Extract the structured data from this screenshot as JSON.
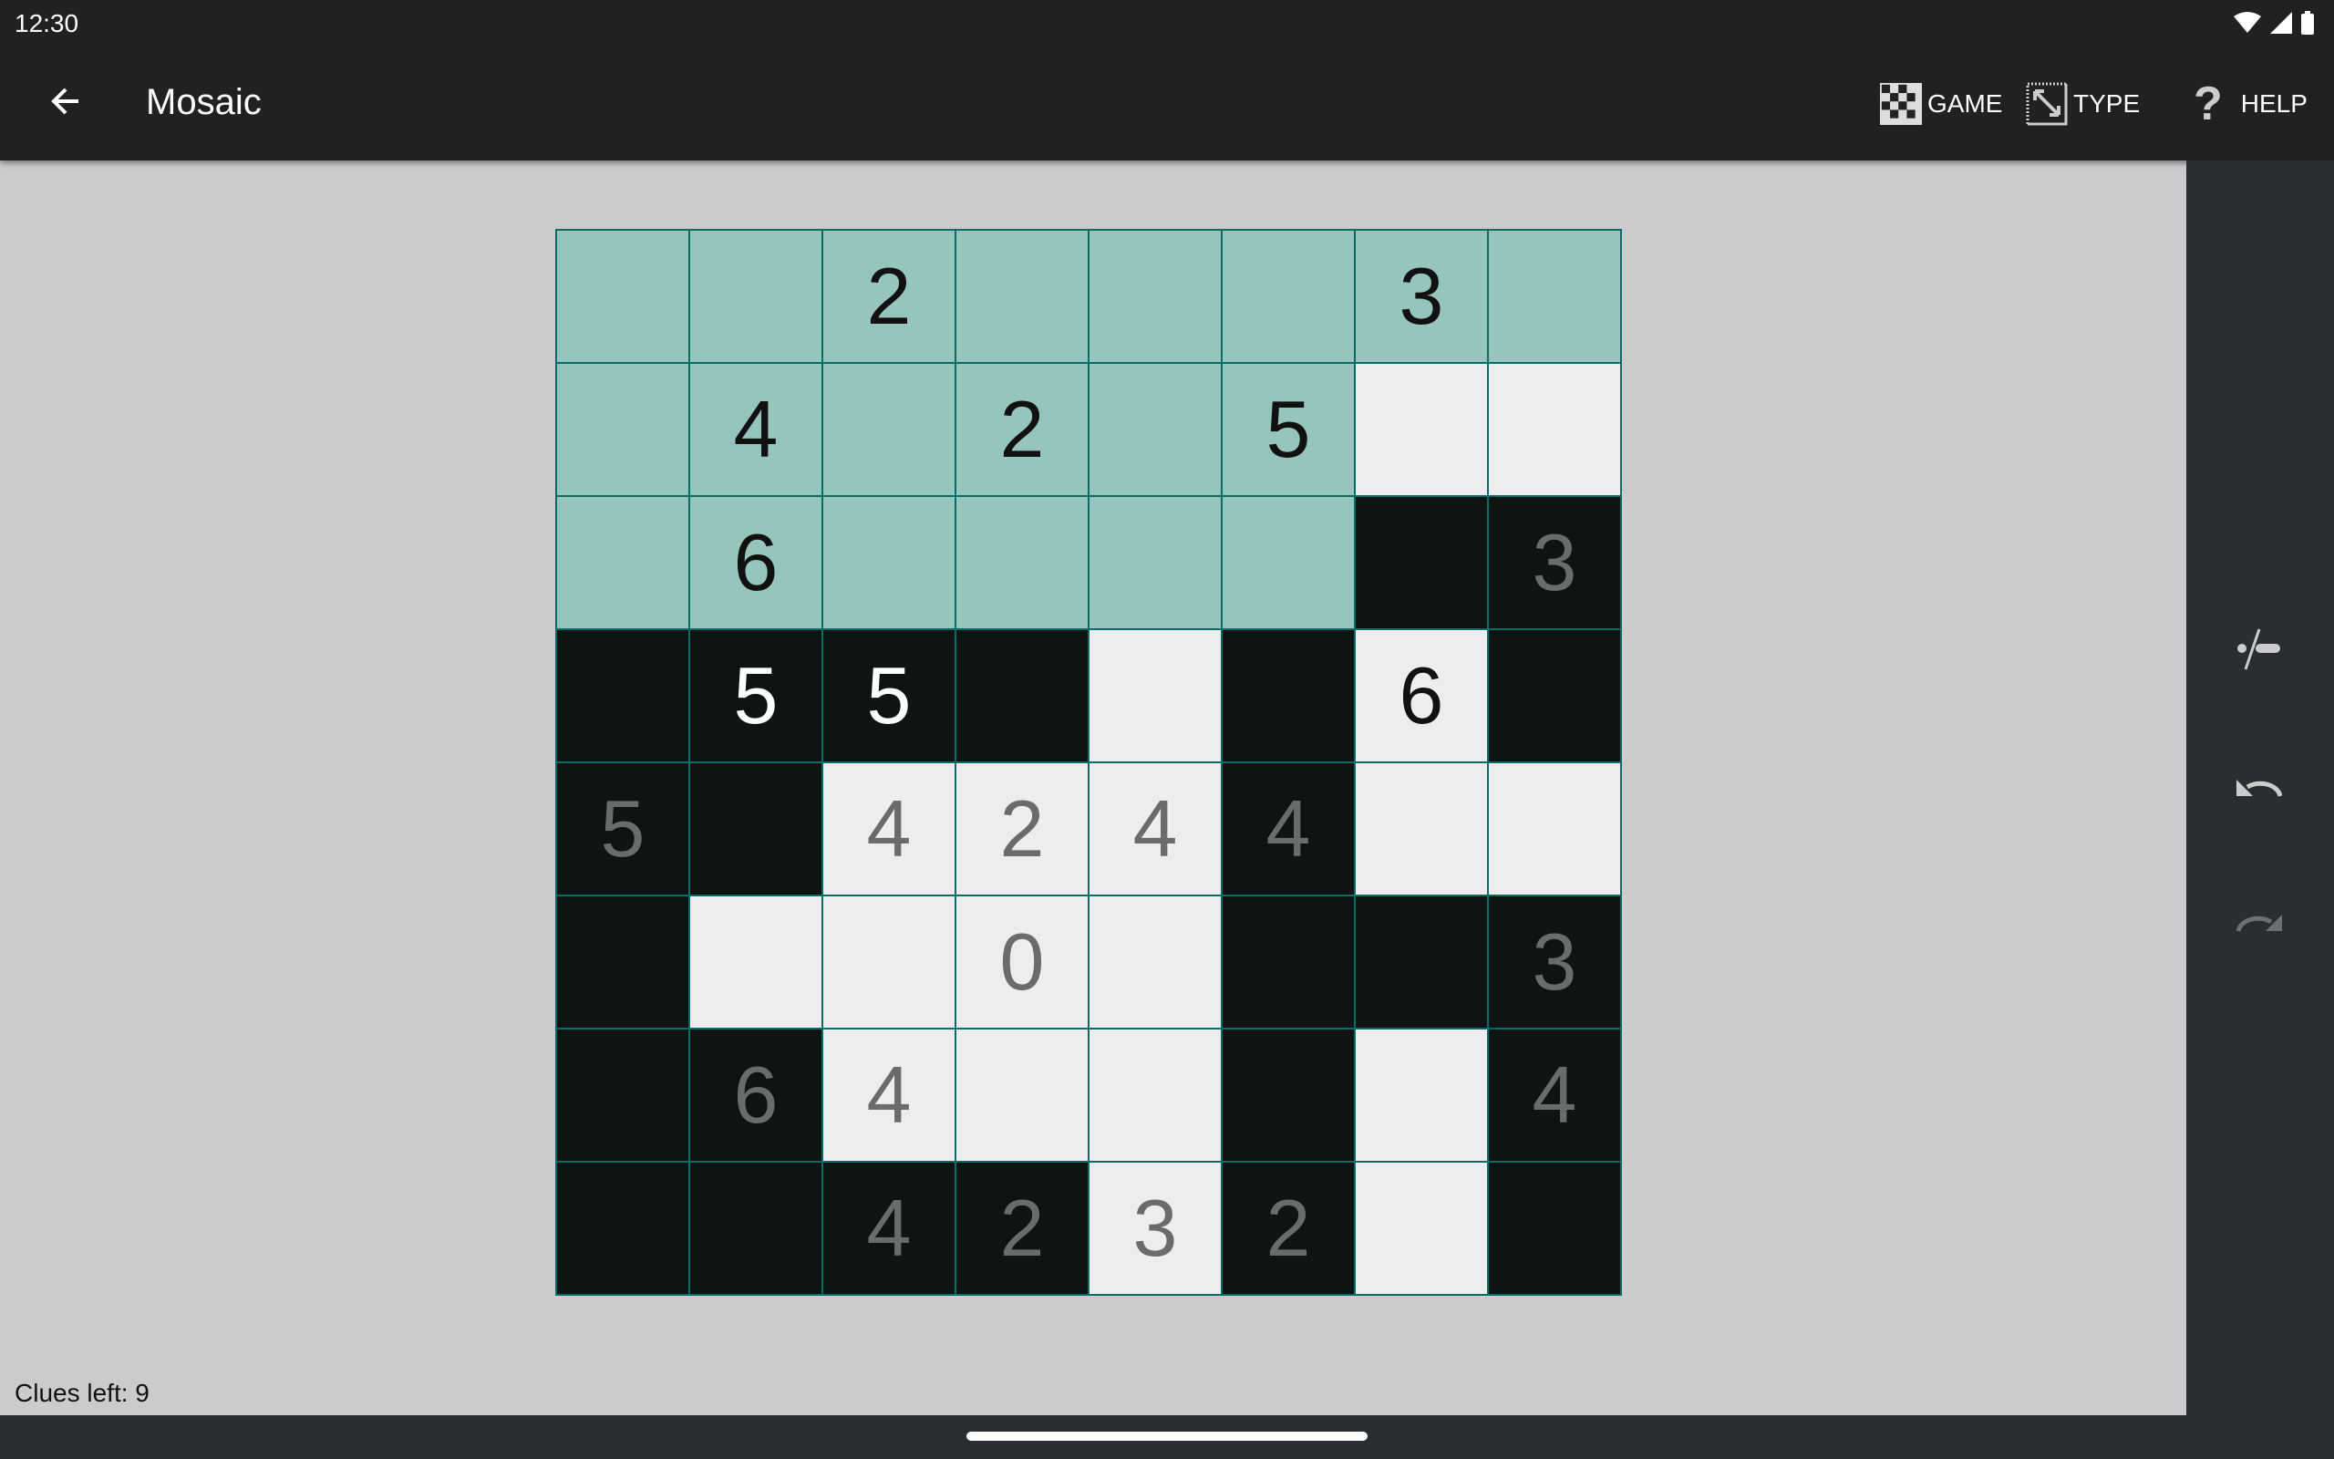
{
  "status": {
    "time": "12:30"
  },
  "appbar": {
    "title": "Mosaic",
    "actions": [
      {
        "label": "GAME",
        "icon": "checkerboard-icon"
      },
      {
        "label": "TYPE",
        "icon": "resize-icon"
      },
      {
        "label": "HELP",
        "icon": "help-icon"
      }
    ]
  },
  "sidebar": {
    "items": [
      {
        "icon": "mark-toggle-icon"
      },
      {
        "icon": "undo-icon"
      },
      {
        "icon": "redo-icon",
        "disabled": true
      }
    ]
  },
  "colors": {
    "unknown": "#95c5bd",
    "white": "#efecef",
    "black": "#0e1412",
    "grid": "#0b6b66"
  },
  "board": {
    "rows": [
      [
        [
          "T",
          ""
        ],
        [
          "T",
          ""
        ],
        [
          "T",
          "2",
          "dark"
        ],
        [
          "T",
          ""
        ],
        [
          "T",
          ""
        ],
        [
          "T",
          ""
        ],
        [
          "T",
          "3",
          "dark"
        ],
        [
          "T",
          ""
        ]
      ],
      [
        [
          "T",
          ""
        ],
        [
          "T",
          "4",
          "dark"
        ],
        [
          "T",
          ""
        ],
        [
          "T",
          "2",
          "dark"
        ],
        [
          "T",
          ""
        ],
        [
          "T",
          "5",
          "dark"
        ],
        [
          "W",
          ""
        ],
        [
          "W",
          ""
        ]
      ],
      [
        [
          "T",
          ""
        ],
        [
          "T",
          "6",
          "dark"
        ],
        [
          "T",
          ""
        ],
        [
          "T",
          ""
        ],
        [
          "T",
          ""
        ],
        [
          "T",
          ""
        ],
        [
          "B",
          ""
        ],
        [
          "B",
          "3",
          "gray"
        ]
      ],
      [
        [
          "B",
          ""
        ],
        [
          "B",
          "5",
          "light"
        ],
        [
          "B",
          "5",
          "light"
        ],
        [
          "B",
          ""
        ],
        [
          "W",
          ""
        ],
        [
          "B",
          ""
        ],
        [
          "W",
          "6",
          "dark"
        ],
        [
          "B",
          ""
        ]
      ],
      [
        [
          "B",
          "5",
          "gray"
        ],
        [
          "B",
          ""
        ],
        [
          "W",
          "4",
          "gray"
        ],
        [
          "W",
          "2",
          "gray"
        ],
        [
          "W",
          "4",
          "gray"
        ],
        [
          "B",
          "4",
          "gray"
        ],
        [
          "W",
          ""
        ],
        [
          "W",
          ""
        ]
      ],
      [
        [
          "B",
          ""
        ],
        [
          "W",
          ""
        ],
        [
          "W",
          ""
        ],
        [
          "W",
          "0",
          "gray"
        ],
        [
          "W",
          ""
        ],
        [
          "B",
          ""
        ],
        [
          "B",
          ""
        ],
        [
          "B",
          "3",
          "gray"
        ]
      ],
      [
        [
          "B",
          ""
        ],
        [
          "B",
          "6",
          "gray"
        ],
        [
          "W",
          "4",
          "gray"
        ],
        [
          "W",
          ""
        ],
        [
          "W",
          ""
        ],
        [
          "B",
          ""
        ],
        [
          "W",
          ""
        ],
        [
          "B",
          "4",
          "gray"
        ]
      ],
      [
        [
          "B",
          ""
        ],
        [
          "B",
          ""
        ],
        [
          "B",
          "4",
          "gray"
        ],
        [
          "B",
          "2",
          "gray"
        ],
        [
          "W",
          "3",
          "gray"
        ],
        [
          "B",
          "2",
          "gray"
        ],
        [
          "W",
          ""
        ],
        [
          "B",
          ""
        ]
      ]
    ]
  },
  "footer": {
    "clues_left": "Clues left: 9"
  }
}
